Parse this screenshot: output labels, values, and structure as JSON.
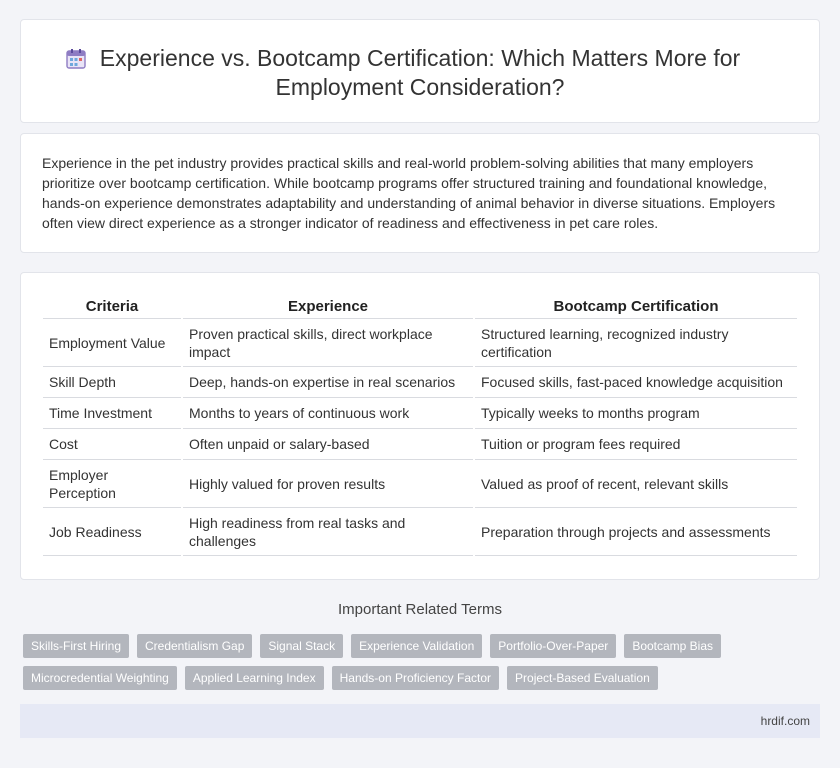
{
  "header": {
    "title_line1": "Experience vs. Bootcamp Certification: Which Matters More for",
    "title_line2": "Employment Consideration?",
    "icon": "calendar-icon"
  },
  "intro": {
    "text": "Experience in the pet industry provides practical skills and real-world problem-solving abilities that many employers prioritize over bootcamp certification. While bootcamp programs offer structured training and foundational knowledge, hands-on experience demonstrates adaptability and understanding of animal behavior in diverse situations. Employers often view direct experience as a stronger indicator of readiness and effectiveness in pet care roles."
  },
  "table": {
    "headers": [
      "Criteria",
      "Experience",
      "Bootcamp Certification"
    ],
    "rows": [
      [
        "Employment Value",
        "Proven practical skills, direct workplace impact",
        "Structured learning, recognized industry certification"
      ],
      [
        "Skill Depth",
        "Deep, hands-on expertise in real scenarios",
        "Focused skills, fast-paced knowledge acquisition"
      ],
      [
        "Time Investment",
        "Months to years of continuous work",
        "Typically weeks to months program"
      ],
      [
        "Cost",
        "Often unpaid or salary-based",
        "Tuition or program fees required"
      ],
      [
        "Employer Perception",
        "Highly valued for proven results",
        "Valued as proof of recent, relevant skills"
      ],
      [
        "Job Readiness",
        "High readiness from real tasks and challenges",
        "Preparation through projects and assessments"
      ]
    ]
  },
  "terms": {
    "heading": "Important Related Terms",
    "row1": [
      "Skills-First Hiring",
      "Credentialism Gap",
      "Signal Stack",
      "Experience Validation",
      "Portfolio-Over-Paper",
      "Bootcamp Bias"
    ],
    "row2": [
      "Microcredential Weighting",
      "Applied Learning Index",
      "Hands-on Proficiency Factor",
      "Project-Based Evaluation"
    ]
  },
  "footer": {
    "site": "hrdif.com"
  }
}
